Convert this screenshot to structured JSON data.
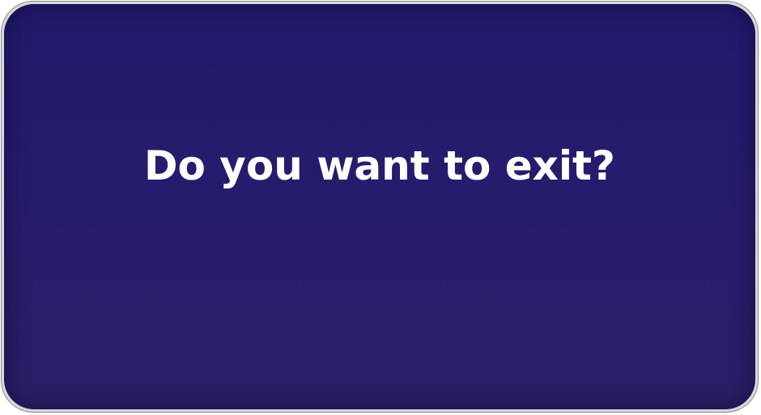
{
  "dialog": {
    "title": "Do you want to exit?"
  },
  "colors": {
    "panel_top": "#211a6b",
    "panel_bottom": "#2a1f66",
    "title_text": "#ffffff",
    "frame_border": "#8a8a8a"
  }
}
